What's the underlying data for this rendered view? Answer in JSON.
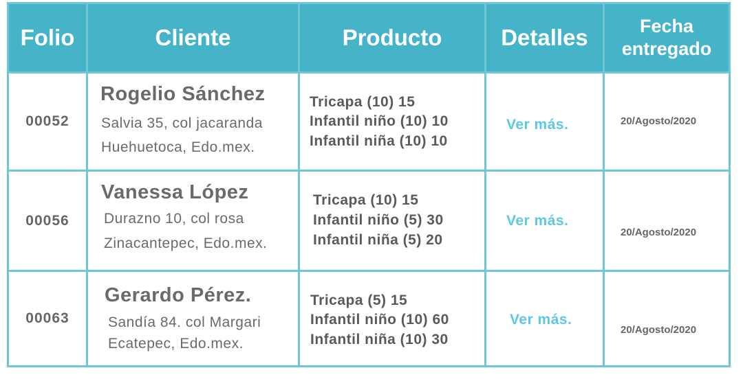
{
  "headers": {
    "folio": "Folio",
    "cliente": "Cliente",
    "producto": "Producto",
    "detalles": "Detalles",
    "fecha_line1": "Fecha",
    "fecha_line2": "entregado"
  },
  "colors": {
    "header_bg": "#45b3c8",
    "border": "#6ec6d6",
    "link": "#5bc8e8"
  },
  "rows": [
    {
      "folio": "00052",
      "cliente_nombre": "Rogelio Sánchez",
      "cliente_dir1": "Salvia 35, col jacaranda",
      "cliente_dir2": "Huehuetoca, Edo.mex.",
      "productos": [
        "Tricapa (10) 15",
        "Infantil niño (10) 10",
        "Infantil niña (10) 10"
      ],
      "detalles": "Ver más.",
      "fecha": "20/Agosto/2020"
    },
    {
      "folio": "00056",
      "cliente_nombre": "Vanessa López",
      "cliente_dir1": "Durazno 10, col rosa",
      "cliente_dir2": "Zinacantepec, Edo.mex.",
      "productos": [
        "Tricapa (10) 15",
        "Infantil niño (5) 30",
        "Infantil niña (5) 20"
      ],
      "detalles": "Ver más.",
      "fecha": "20/Agosto/2020"
    },
    {
      "folio": "00063",
      "cliente_nombre": "Gerardo Pérez.",
      "cliente_dir1": "Sandía 84. col Margari",
      "cliente_dir2": "Ecatepec, Edo.mex.",
      "productos": [
        "Tricapa (5) 15",
        "Infantil niño (10) 60",
        "Infantil niña (10) 30"
      ],
      "detalles": "Ver más.",
      "fecha": "20/Agosto/2020"
    }
  ]
}
